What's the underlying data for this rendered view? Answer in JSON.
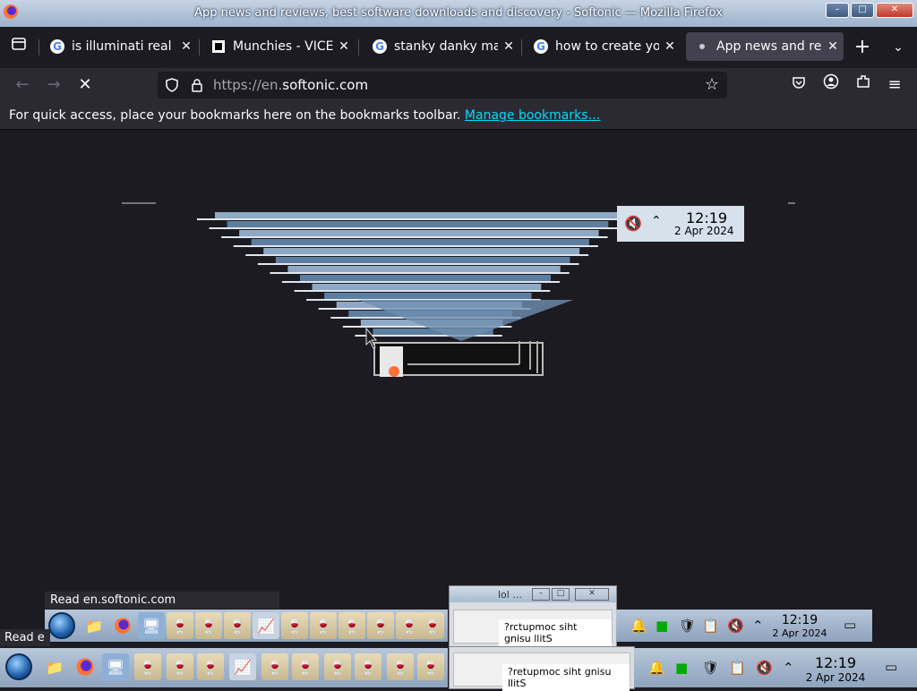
{
  "window": {
    "title": "App news and reviews, best software downloads and discovery - Softonic — Mozilla Firefox",
    "minimize_icon": "minimize-icon",
    "maximize_icon": "maximize-icon",
    "close_icon": "close-icon"
  },
  "tabs": [
    {
      "label": "is illuminati real - Y",
      "favicon": "google-icon"
    },
    {
      "label": "Munchies - VICE",
      "favicon": "vice-icon"
    },
    {
      "label": "stanky danky may",
      "favicon": "google-icon"
    },
    {
      "label": "how to create you",
      "favicon": "google-icon"
    },
    {
      "label": "App news and rev",
      "favicon": "loading-icon",
      "active": true
    }
  ],
  "navigation": {
    "url_prefix": "https://en.",
    "url_host": "softonic.com",
    "bookmarks_message": "For quick access, place your bookmarks here on the bookmarks toolbar.",
    "manage_bookmarks": "Manage bookmarks…"
  },
  "clock_popup": {
    "time": "12:19",
    "date": "2 Apr 2024"
  },
  "status": {
    "read_full": "Read en.softonic.com",
    "read_partial": "Read e"
  },
  "taskbar_upper": {
    "time": "12:19",
    "date": "2 Apr 2024"
  },
  "taskbar_lower": {
    "time": "12:19",
    "date": "2 Apr 2024"
  },
  "mini_window": {
    "title": "lol ...",
    "message_upper": "?rctupmoc siht gnisu llitS",
    "message_lower": "?retupmoc siht gnisu llitS"
  },
  "colors": {
    "accent": "#00ddff",
    "background": "#1c1b22",
    "toolbar": "#2b2a33"
  }
}
